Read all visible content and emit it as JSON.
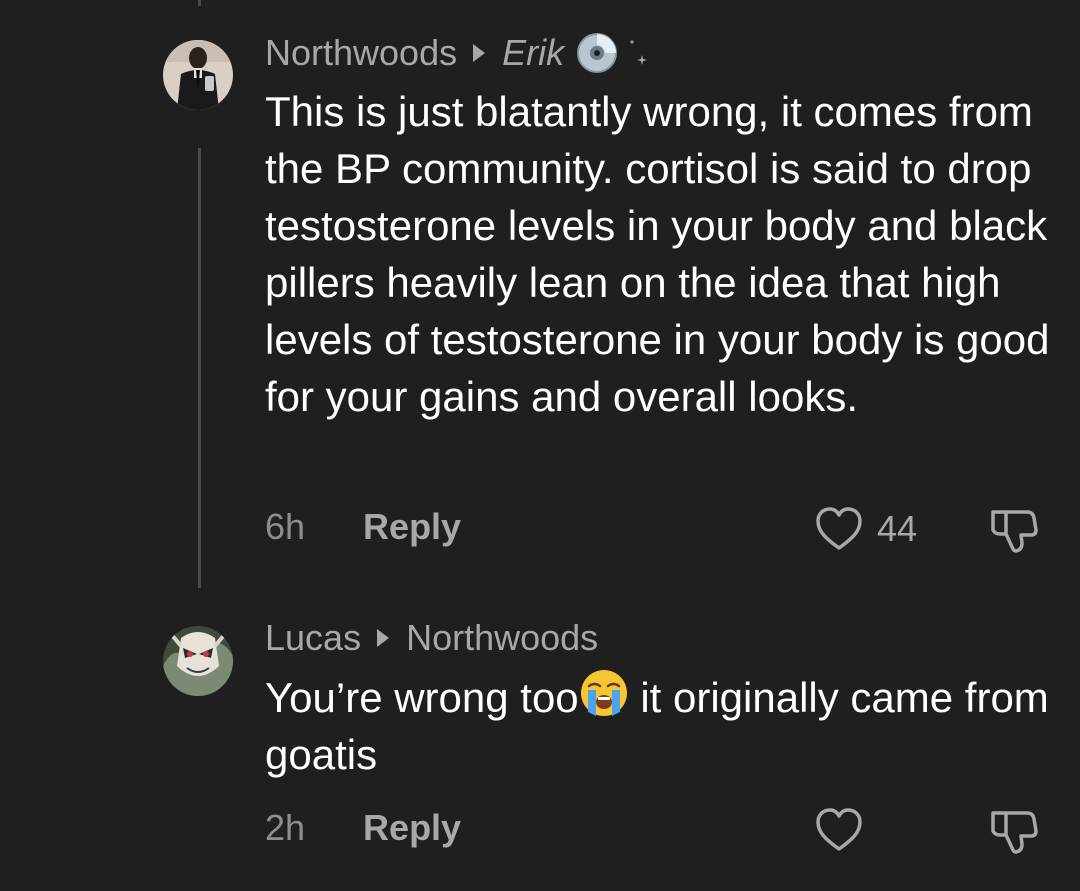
{
  "comments": [
    {
      "author": "Northwoods",
      "reply_to": "Erik",
      "reply_to_badges": [
        "cd-disc-icon",
        "sparkle-icon"
      ],
      "text": "This is just blatantly wrong, it comes from the BP community. cortisol is said to drop testosterone levels in your body and black pillers heavily lean on the idea that high levels of testosterone in your body is good for your gains and overall looks.",
      "time": "6h",
      "reply_label": "Reply",
      "likes": "44"
    },
    {
      "author": "Lucas",
      "reply_to": "Northwoods",
      "text_before_emoji": "You’re wrong too",
      "emoji": "loudly-crying-face",
      "text_after_emoji": " it originally came from goatis",
      "time": "2h",
      "reply_label": "Reply",
      "likes": ""
    }
  ],
  "colors": {
    "background": "#1f1f1f",
    "primary_text": "#ffffff",
    "secondary_text": "#a8a8a8",
    "thread_line": "#4a4a4a"
  }
}
